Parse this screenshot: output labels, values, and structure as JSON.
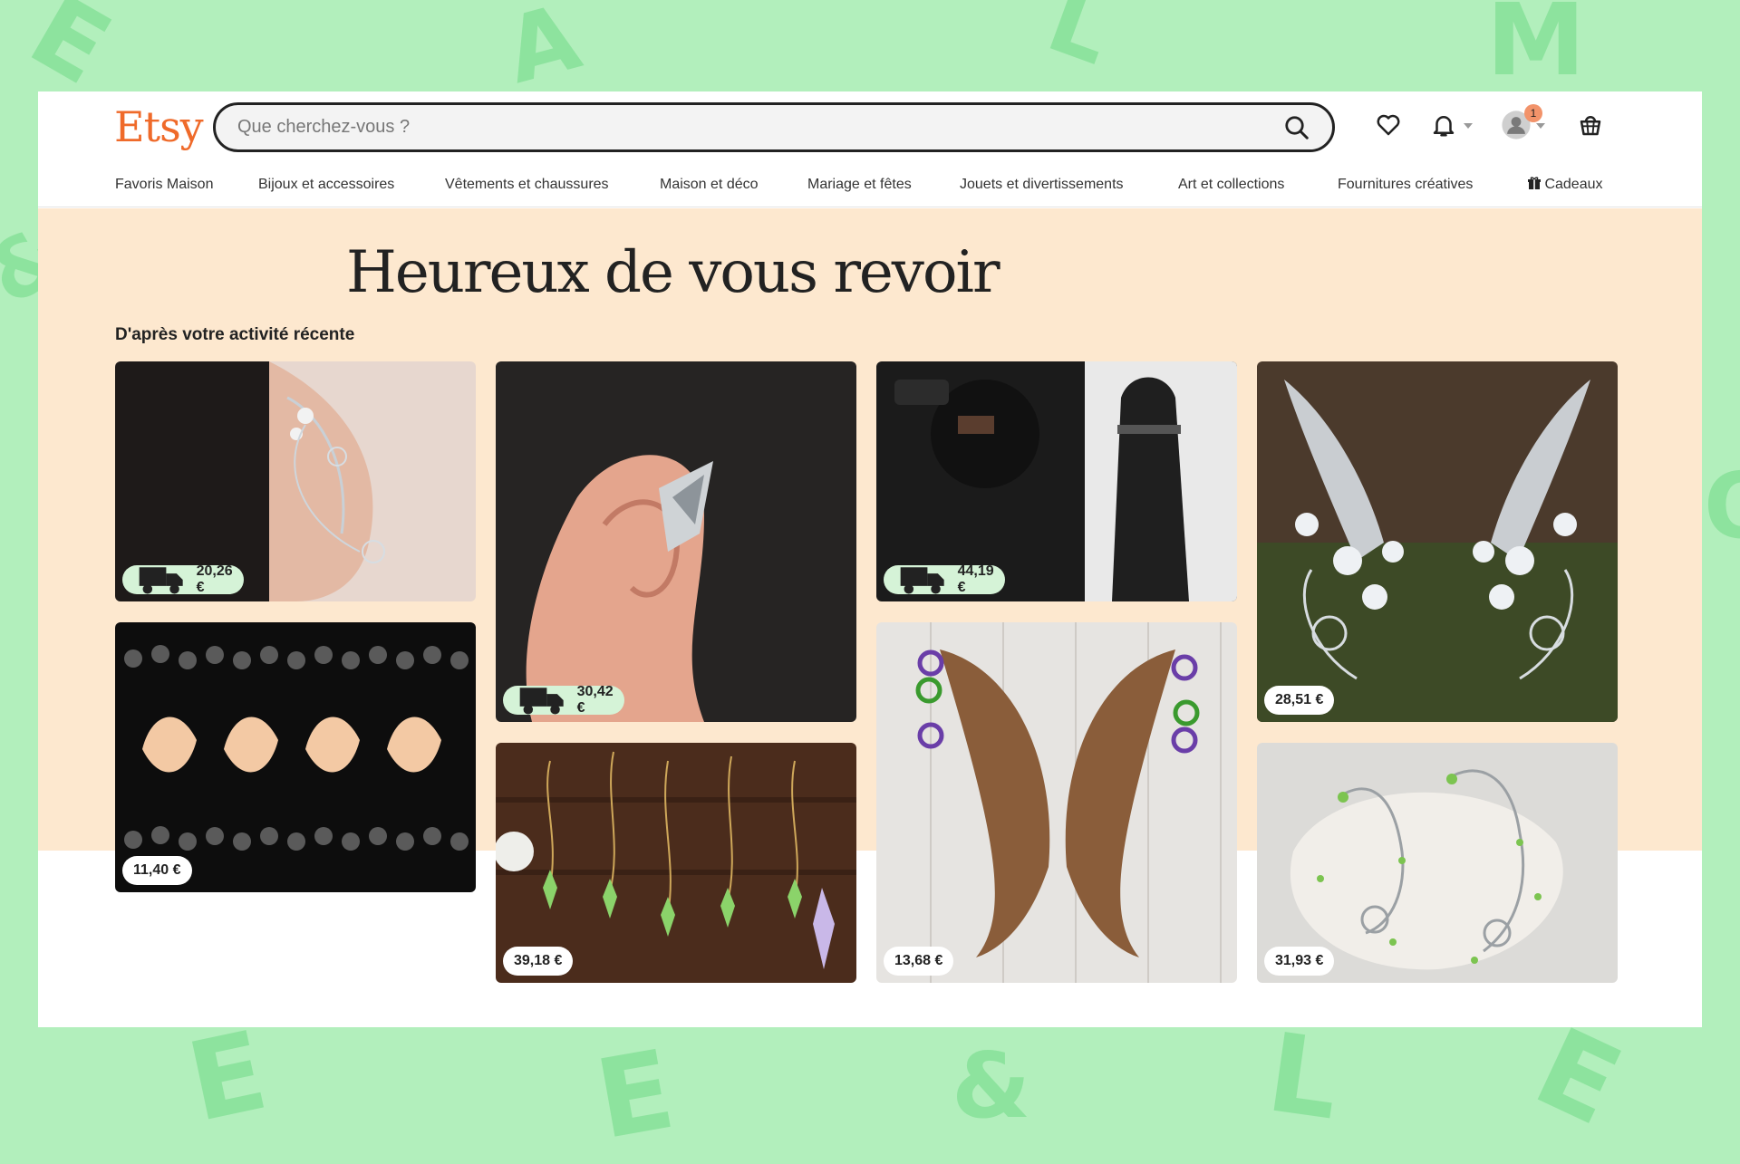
{
  "header": {
    "logo": "Etsy",
    "search_placeholder": "Que cherchez-vous ?",
    "notification_badge": "1"
  },
  "nav": {
    "items": [
      "Favoris Maison",
      "Bijoux et accessoires",
      "Vêtements et chaussures",
      "Maison et déco",
      "Mariage et fêtes",
      "Jouets et divertissements",
      "Art et collections",
      "Fournitures créatives",
      "Cadeaux"
    ]
  },
  "hero": {
    "title": "Heureux de vous revoir",
    "section_label": "D'après votre activité récente"
  },
  "listings": [
    {
      "price": "20,26 €",
      "free_shipping": true,
      "icon": "truck-icon"
    },
    {
      "price": "11,40 €",
      "free_shipping": false
    },
    {
      "price": "30,42 €",
      "free_shipping": true,
      "icon": "truck-icon"
    },
    {
      "price": "39,18 €",
      "free_shipping": false
    },
    {
      "price": "44,19 €",
      "free_shipping": true,
      "icon": "truck-icon"
    },
    {
      "price": "13,68 €",
      "free_shipping": false
    },
    {
      "price": "28,51 €",
      "free_shipping": false
    },
    {
      "price": "31,93 €",
      "free_shipping": false
    }
  ],
  "colors": {
    "brand": "#ef6a2a",
    "hero_bg": "#fde8cf",
    "page_bg": "#b2efbc",
    "shipping_badge": "#d5f3d7"
  }
}
